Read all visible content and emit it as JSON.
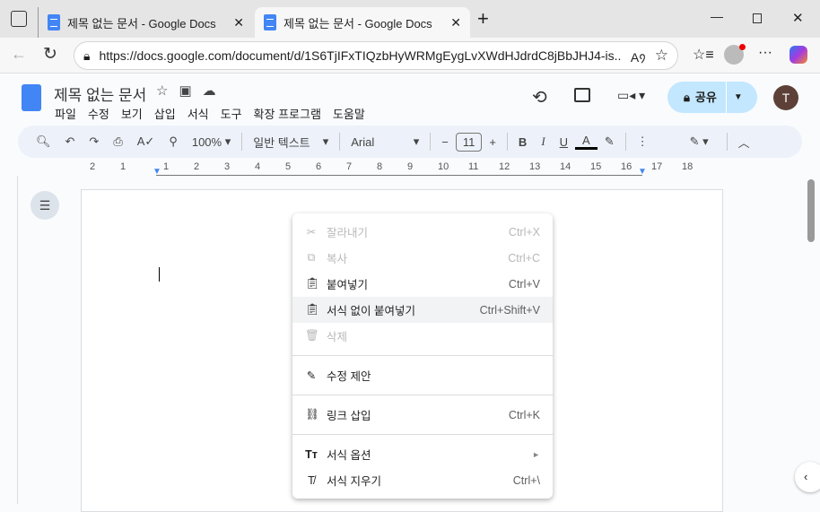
{
  "browser": {
    "tabs": [
      {
        "title": "제목 없는 문서 - Google Docs",
        "active": false
      },
      {
        "title": "제목 없는 문서 - Google Docs",
        "active": true
      }
    ],
    "url": "https://docs.google.com/document/d/1S6TjIFxTIQzbHyWRMgEygLvXWdHJdrdC8jBbJHJ4-is..."
  },
  "doc": {
    "title": "제목 없는 문서",
    "menus": [
      "파일",
      "수정",
      "보기",
      "삽입",
      "서식",
      "도구",
      "확장 프로그램",
      "도움말"
    ],
    "share": "공유",
    "avatar": "T"
  },
  "toolbar": {
    "zoom": "100%",
    "style": "일반 텍스트",
    "font": "Arial",
    "size": "11",
    "text_color": "#000000"
  },
  "ruler": {
    "labels": [
      "2",
      "1",
      "1",
      "2",
      "3",
      "4",
      "5",
      "6",
      "7",
      "8",
      "9",
      "10",
      "11",
      "12",
      "13",
      "14",
      "15",
      "16",
      "17",
      "18"
    ]
  },
  "context_menu": {
    "items": [
      {
        "label": "잘라내기",
        "shortcut": "Ctrl+X",
        "icon": "scissors-icon",
        "disabled": true
      },
      {
        "label": "복사",
        "shortcut": "Ctrl+C",
        "icon": "copy-icon",
        "disabled": true
      },
      {
        "label": "붙여넣기",
        "shortcut": "Ctrl+V",
        "icon": "clipboard-icon",
        "disabled": false
      },
      {
        "label": "서식 없이 붙여넣기",
        "shortcut": "Ctrl+Shift+V",
        "icon": "paste-plain-icon",
        "disabled": false,
        "highlighted": true
      },
      {
        "label": "삭제",
        "shortcut": "",
        "icon": "trash-icon",
        "disabled": true
      },
      {
        "label": "수정 제안",
        "shortcut": "",
        "icon": "suggest-edit-icon",
        "disabled": false
      },
      {
        "label": "링크 삽입",
        "shortcut": "Ctrl+K",
        "icon": "link-icon",
        "disabled": false
      },
      {
        "label": "서식 옵션",
        "shortcut": "►",
        "icon": "text-format-icon",
        "disabled": false
      },
      {
        "label": "서식 지우기",
        "shortcut": "Ctrl+\\",
        "icon": "clear-format-icon",
        "disabled": false
      }
    ]
  }
}
